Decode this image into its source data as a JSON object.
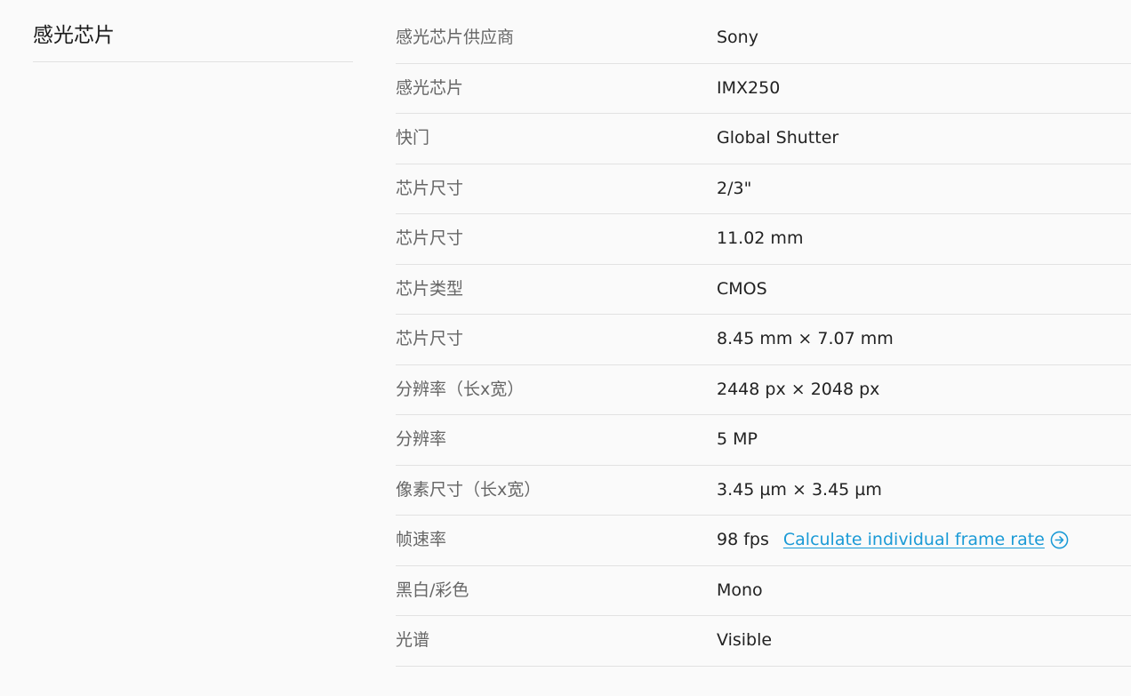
{
  "section": {
    "title": "感光芯片"
  },
  "specs": [
    {
      "label": "感光芯片供应商",
      "value": "Sony"
    },
    {
      "label": "感光芯片",
      "value": "IMX250"
    },
    {
      "label": "快门",
      "value": "Global Shutter"
    },
    {
      "label": "芯片尺寸",
      "value": "2/3\""
    },
    {
      "label": "芯片尺寸",
      "value": "11.02 mm"
    },
    {
      "label": "芯片类型",
      "value": "CMOS"
    },
    {
      "label": "芯片尺寸",
      "value": "8.45 mm × 7.07 mm"
    },
    {
      "label": "分辨率（长x宽）",
      "value": "2448 px × 2048 px"
    },
    {
      "label": "分辨率",
      "value": "5 MP"
    },
    {
      "label": "像素尺寸（长x宽）",
      "value": "3.45 µm × 3.45 µm"
    },
    {
      "label": "帧速率",
      "value": "98 fps",
      "link": "Calculate individual frame rate",
      "link_icon": "arrow-circle-right-icon"
    },
    {
      "label": "黑白/彩色",
      "value": "Mono"
    },
    {
      "label": "光谱",
      "value": "Visible"
    }
  ],
  "colors": {
    "link": "#1a9ad6",
    "label": "#666666",
    "value": "#222222",
    "divider": "#e2e2e2",
    "background": "#fafafa"
  }
}
